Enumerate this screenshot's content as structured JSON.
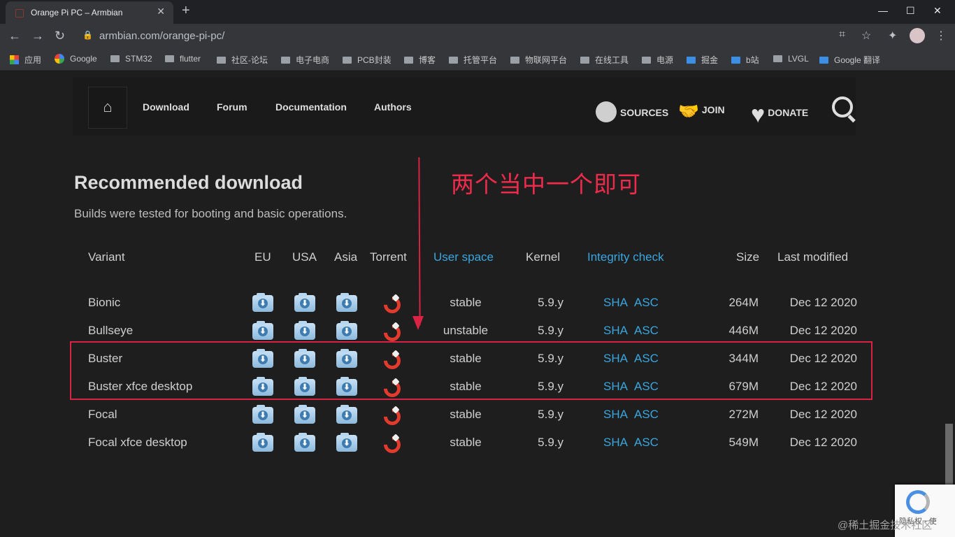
{
  "browser": {
    "tab_title": "Orange Pi PC – Armbian",
    "tab_close": "✕",
    "new_tab": "+",
    "win_min": "—",
    "win_max": "☐",
    "win_close": "✕",
    "back": "←",
    "forward": "→",
    "reload": "↻",
    "lock": "🔒",
    "url": "armbian.com/orange-pi-pc/",
    "translate": "⌗",
    "star": "☆",
    "extensions": "✦",
    "menu": "⋮",
    "bookmarks": [
      {
        "label": "应用",
        "icon": "apps-icon"
      },
      {
        "label": "Google",
        "icon": "google-icon"
      },
      {
        "label": "STM32",
        "icon": "folder-icon"
      },
      {
        "label": "flutter",
        "icon": "folder-icon"
      },
      {
        "label": "社区-论坛",
        "icon": "folder-icon"
      },
      {
        "label": "电子电商",
        "icon": "folder-icon"
      },
      {
        "label": "PCB封装",
        "icon": "folder-icon"
      },
      {
        "label": "博客",
        "icon": "folder-icon"
      },
      {
        "label": "托管平台",
        "icon": "folder-icon"
      },
      {
        "label": "物联网平台",
        "icon": "folder-icon"
      },
      {
        "label": "在线工具",
        "icon": "folder-icon"
      },
      {
        "label": "电源",
        "icon": "folder-icon"
      },
      {
        "label": "掘金",
        "icon": "juejin-icon"
      },
      {
        "label": "b站",
        "icon": "bilibili-icon"
      },
      {
        "label": "LVGL",
        "icon": "folder-icon"
      },
      {
        "label": "Google 翻译",
        "icon": "google-translate-icon"
      }
    ]
  },
  "nav": {
    "home_icon": "⌂",
    "links": [
      "Download",
      "Forum",
      "Documentation",
      "Authors"
    ],
    "sources": "SOURCES",
    "join": "JOIN",
    "donate": "DONATE",
    "sources_icon": "●",
    "join_icon": "🤝",
    "donate_icon": "♥"
  },
  "section": {
    "title": "Recommended download",
    "subtitle": "Builds were tested for booting and basic operations."
  },
  "annotation": "两个当中一个即可",
  "table": {
    "headers": {
      "variant": "Variant",
      "eu": "EU",
      "usa": "USA",
      "asia": "Asia",
      "torrent": "Torrent",
      "userspace": "User space",
      "kernel": "Kernel",
      "integrity": "Integrity check",
      "size": "Size",
      "modified": "Last modified"
    },
    "rows": [
      {
        "variant": "Bionic",
        "userspace": "stable",
        "kernel": "5.9.y",
        "sha": "SHA",
        "asc": "ASC",
        "size": "264M",
        "modified": "Dec 12 2020"
      },
      {
        "variant": "Bullseye",
        "userspace": "unstable",
        "kernel": "5.9.y",
        "sha": "SHA",
        "asc": "ASC",
        "size": "446M",
        "modified": "Dec 12 2020"
      },
      {
        "variant": "Buster",
        "userspace": "stable",
        "kernel": "5.9.y",
        "sha": "SHA",
        "asc": "ASC",
        "size": "344M",
        "modified": "Dec 12 2020"
      },
      {
        "variant": "Buster xfce desktop",
        "userspace": "stable",
        "kernel": "5.9.y",
        "sha": "SHA",
        "asc": "ASC",
        "size": "679M",
        "modified": "Dec 12 2020"
      },
      {
        "variant": "Focal",
        "userspace": "stable",
        "kernel": "5.9.y",
        "sha": "SHA",
        "asc": "ASC",
        "size": "272M",
        "modified": "Dec 12 2020"
      },
      {
        "variant": "Focal xfce desktop",
        "userspace": "stable",
        "kernel": "5.9.y",
        "sha": "SHA",
        "asc": "ASC",
        "size": "549M",
        "modified": "Dec 12 2020"
      }
    ]
  },
  "recaptcha_text": "隐私权 - 使",
  "watermark": "@稀土掘金技术社区",
  "download_glyph": "⬇"
}
